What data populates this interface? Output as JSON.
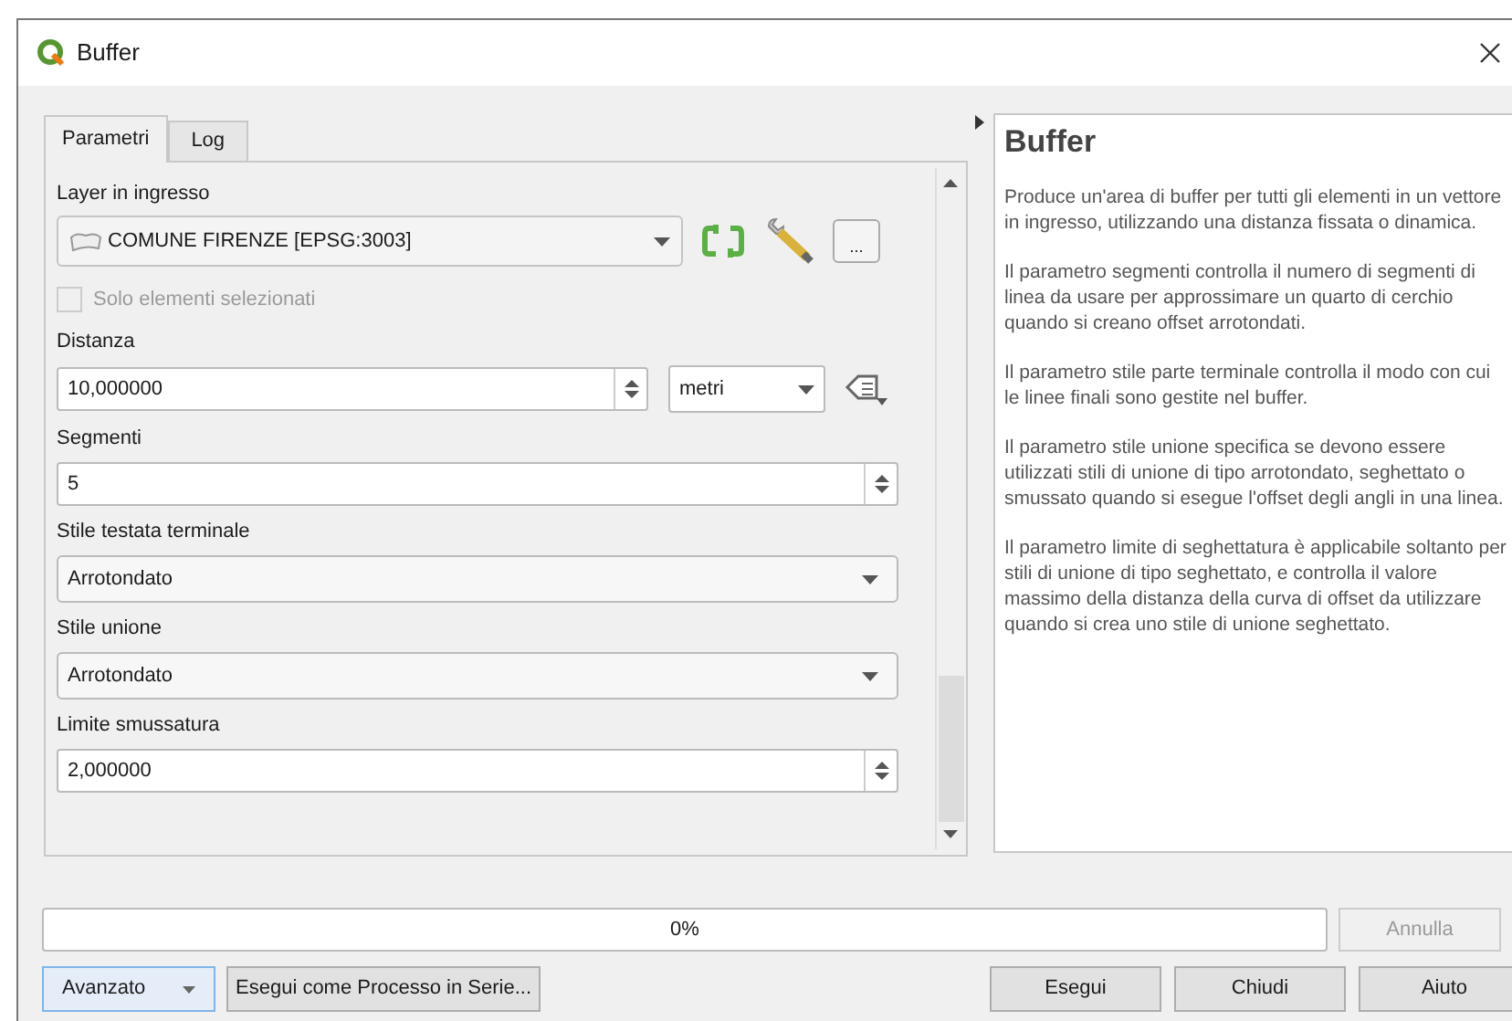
{
  "window": {
    "title": "Buffer"
  },
  "tabs": [
    {
      "label": "Parametri",
      "selected": true
    },
    {
      "label": "Log",
      "selected": false
    }
  ],
  "parameters": [
    {
      "kind": "label",
      "text": "Layer in ingresso"
    },
    {
      "kind": "layer",
      "value": "COMUNE FIRENZE [EPSG:3003]",
      "more": "..."
    },
    {
      "kind": "checkbox",
      "text": "Solo elementi selezionati",
      "checked": false,
      "disabled": true
    },
    {
      "kind": "label",
      "text": "Distanza"
    },
    {
      "kind": "distance",
      "value": "10,000000",
      "unit": "metri"
    },
    {
      "kind": "label",
      "text": "Segmenti"
    },
    {
      "kind": "spin",
      "value": "5"
    },
    {
      "kind": "label",
      "text": "Stile testata terminale"
    },
    {
      "kind": "select",
      "value": "Arrotondato"
    },
    {
      "kind": "label",
      "text": "Stile unione"
    },
    {
      "kind": "select",
      "value": "Arrotondato"
    },
    {
      "kind": "label",
      "text": "Limite smussatura"
    },
    {
      "kind": "spin",
      "value": "2,000000"
    }
  ],
  "help": {
    "title": "Buffer",
    "paragraphs": [
      "Produce un'area di buffer per tutti gli elementi in un vettore in ingresso, utilizzando una distanza fissata o dinamica.",
      "Il parametro segmenti controlla il numero di segmenti di linea da usare per approssimare un quarto di cerchio quando si creano offset arrotondati.",
      "Il parametro stile parte terminale controlla il modo con cui le linee finali sono gestite nel buffer.",
      "Il parametro stile unione specifica se devono essere utilizzati stili di unione di tipo arrotondato, seghettato o smussato quando si esegue l'offset degli angli in una linea.",
      "Il parametro limite di seghettatura è applicabile soltanto per stili di unione di tipo seghettato, e controlla il valore massimo della distanza della curva di offset da utilizzare quando si crea uno stile di unione seghettato."
    ]
  },
  "progress": {
    "text": "0%",
    "level": 0
  },
  "cancel_button": {
    "label": "Annulla",
    "disabled": true
  },
  "advanced_button": {
    "label": "Avanzato"
  },
  "batch_button": {
    "label": "Esegui come Processo in Serie..."
  },
  "buttons": [
    "Esegui",
    "Chiudi",
    "Aiuto"
  ]
}
